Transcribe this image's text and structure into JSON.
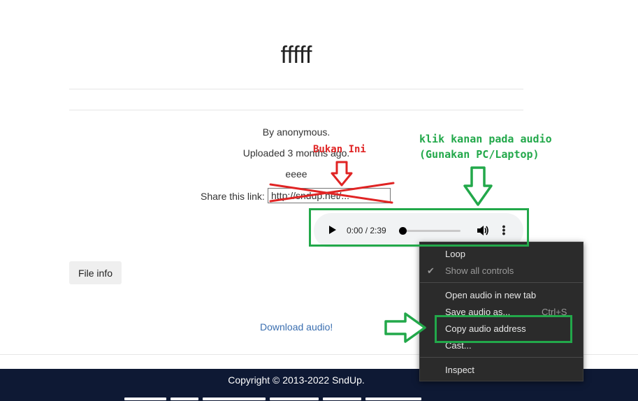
{
  "page": {
    "title": "fffff",
    "by": "By anonymous.",
    "uploaded": "Uploaded 3 months ago.",
    "description": "eeee",
    "share_label": "Share this link:",
    "share_value": "http://sndup.net/...",
    "file_info_label": "File info",
    "download_label": "Download audio!"
  },
  "player": {
    "time": "0:00 / 2:39",
    "progress_fraction": 0.0
  },
  "context_menu": {
    "items": [
      {
        "label": "Loop"
      },
      {
        "label": "Show all controls",
        "disabled": true,
        "checked": true
      },
      {
        "label": "Open audio in new tab"
      },
      {
        "label": "Save audio as...",
        "shortcut": "Ctrl+S"
      },
      {
        "label": "Copy audio address"
      },
      {
        "label": "Cast..."
      },
      {
        "label": "Inspect"
      }
    ]
  },
  "annotations": {
    "right_line1": "klik kanan pada audio",
    "right_line2": "(Gunakan PC/Laptop)",
    "left_text": "Bukan Ini"
  },
  "footer": {
    "copyright": "Copyright © 2013-2022 SndUp."
  },
  "colors": {
    "annotation_green": "#22a84a",
    "annotation_red": "#e02424",
    "footer_bg": "#0e1934",
    "menu_bg": "#2b2b2b",
    "link": "#3b6fb0"
  }
}
